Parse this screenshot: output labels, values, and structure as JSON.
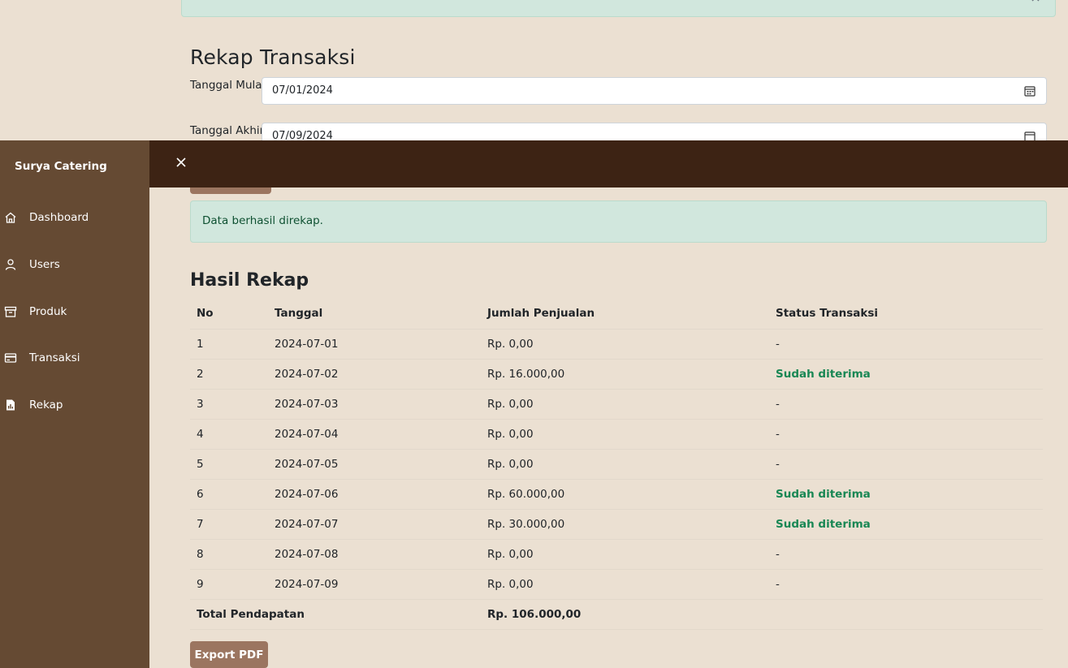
{
  "form": {
    "title": "Rekap Transaksi",
    "start_label": "Tanggal Mulai:",
    "start_value": "07/01/2024",
    "end_label": "Tanggal Akhir:",
    "end_value": "07/09/2024"
  },
  "sidebar": {
    "brand": "Surya Catering",
    "items": [
      {
        "label": "Dashboard",
        "icon": "home-icon"
      },
      {
        "label": "Users",
        "icon": "user-icon"
      },
      {
        "label": "Produk",
        "icon": "archive-icon"
      },
      {
        "label": "Transaksi",
        "icon": "credit-card-icon"
      },
      {
        "label": "Rekap",
        "icon": "report-file-icon"
      }
    ]
  },
  "alert": {
    "message": "Data berhasil direkap."
  },
  "result": {
    "title": "Hasil Rekap",
    "headers": [
      "No",
      "Tanggal",
      "Jumlah Penjualan",
      "Status Transaksi"
    ],
    "rows": [
      {
        "no": "1",
        "date": "2024-07-01",
        "amount": "Rp. 0,00",
        "status": "-"
      },
      {
        "no": "2",
        "date": "2024-07-02",
        "amount": "Rp. 16.000,00",
        "status": "Sudah diterima"
      },
      {
        "no": "3",
        "date": "2024-07-03",
        "amount": "Rp. 0,00",
        "status": "-"
      },
      {
        "no": "4",
        "date": "2024-07-04",
        "amount": "Rp. 0,00",
        "status": "-"
      },
      {
        "no": "5",
        "date": "2024-07-05",
        "amount": "Rp. 0,00",
        "status": "-"
      },
      {
        "no": "6",
        "date": "2024-07-06",
        "amount": "Rp. 60.000,00",
        "status": "Sudah diterima"
      },
      {
        "no": "7",
        "date": "2024-07-07",
        "amount": "Rp. 30.000,00",
        "status": "Sudah diterima"
      },
      {
        "no": "8",
        "date": "2024-07-08",
        "amount": "Rp. 0,00",
        "status": "-"
      },
      {
        "no": "9",
        "date": "2024-07-09",
        "amount": "Rp. 0,00",
        "status": "-"
      }
    ],
    "total_label": "Total Pendapatan",
    "total_value": "Rp. 106.000,00"
  },
  "export_label": "Export PDF",
  "colors": {
    "sidebar": "#654a33",
    "topbar": "#3d2314",
    "background": "#ebe0d2",
    "button": "#9b7560",
    "success_text": "#198754"
  }
}
